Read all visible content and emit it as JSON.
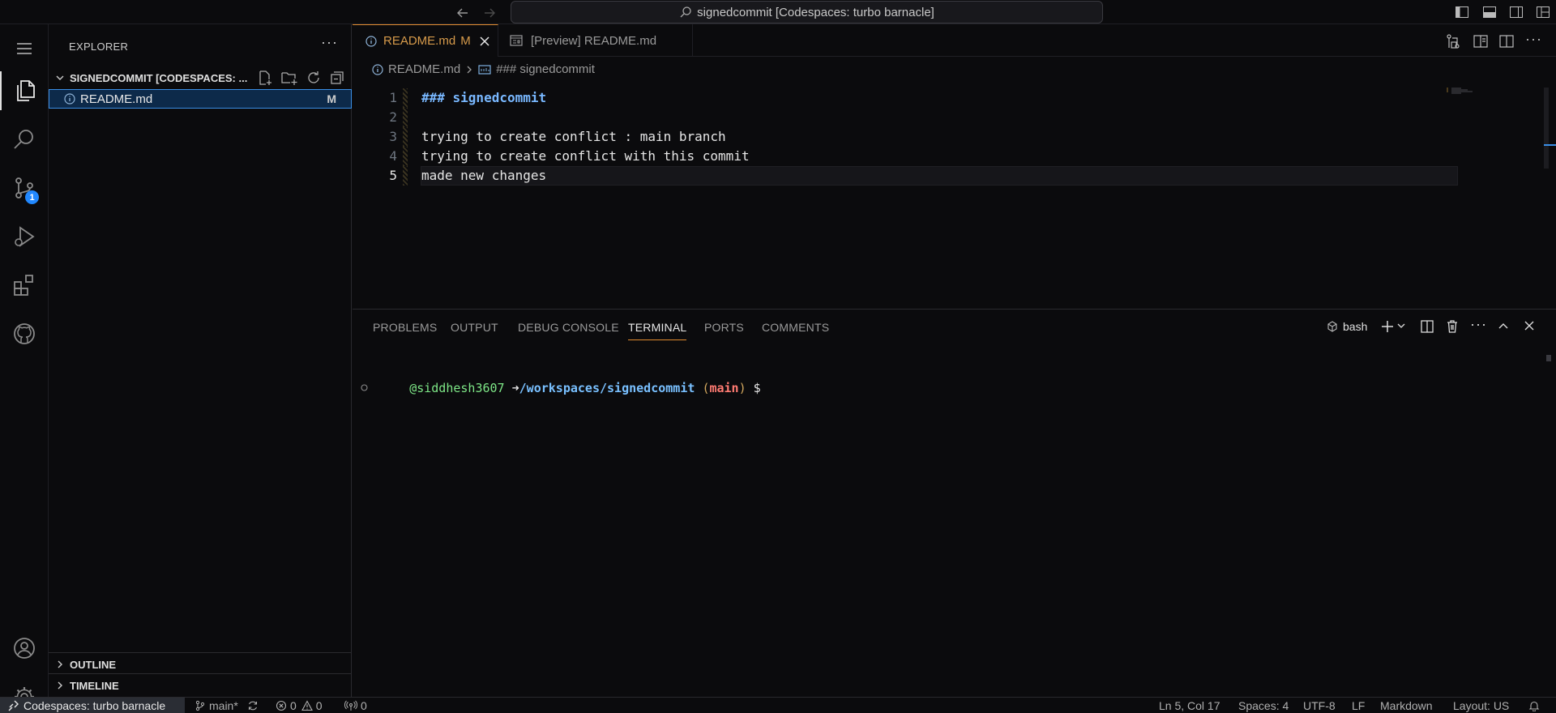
{
  "titlebar": {
    "search_text": "signedcommit [Codespaces: turbo barnacle]"
  },
  "activity": {
    "source_control_badge": "1"
  },
  "sidebar": {
    "title": "EXPLORER",
    "more": "···",
    "workspace_label": "SIGNEDCOMMIT [CODESPACES: ...",
    "file": {
      "name": "README.md",
      "status": "M"
    },
    "outline_label": "OUTLINE",
    "timeline_label": "TIMELINE"
  },
  "editor": {
    "tabs": [
      {
        "label": "README.md",
        "modified": "M"
      },
      {
        "label": "[Preview] README.md"
      }
    ],
    "breadcrumb": {
      "file": "README.md",
      "symbol": "### signedcommit"
    },
    "lines": [
      {
        "num": "1",
        "text": "### signedcommit"
      },
      {
        "num": "2",
        "text": ""
      },
      {
        "num": "3",
        "text": "trying to create conflict : main branch"
      },
      {
        "num": "4",
        "text": "trying to create conflict with this commit"
      },
      {
        "num": "5",
        "text": "made new changes"
      }
    ]
  },
  "panel": {
    "tabs": [
      "PROBLEMS",
      "OUTPUT",
      "DEBUG CONSOLE",
      "TERMINAL",
      "PORTS",
      "COMMENTS"
    ],
    "active_tab": "TERMINAL",
    "shell": "bash",
    "terminal": {
      "user": "@siddhesh3607",
      "arrow": "➜",
      "path": "/workspaces/signedcommit",
      "branch": "main",
      "prompt": "$"
    }
  },
  "statusbar": {
    "remote": "Codespaces: turbo barnacle",
    "branch": "main*",
    "errors": "0",
    "warnings": "0",
    "ports": "0",
    "cursor": "Ln 5, Col 17",
    "spaces": "Spaces: 4",
    "encoding": "UTF-8",
    "eol": "LF",
    "language": "Markdown",
    "layout": "Layout: US"
  },
  "colors": {
    "accent_tab": "#e08a2e",
    "badge": "#2188ff",
    "selection": "#0d2a4a"
  }
}
